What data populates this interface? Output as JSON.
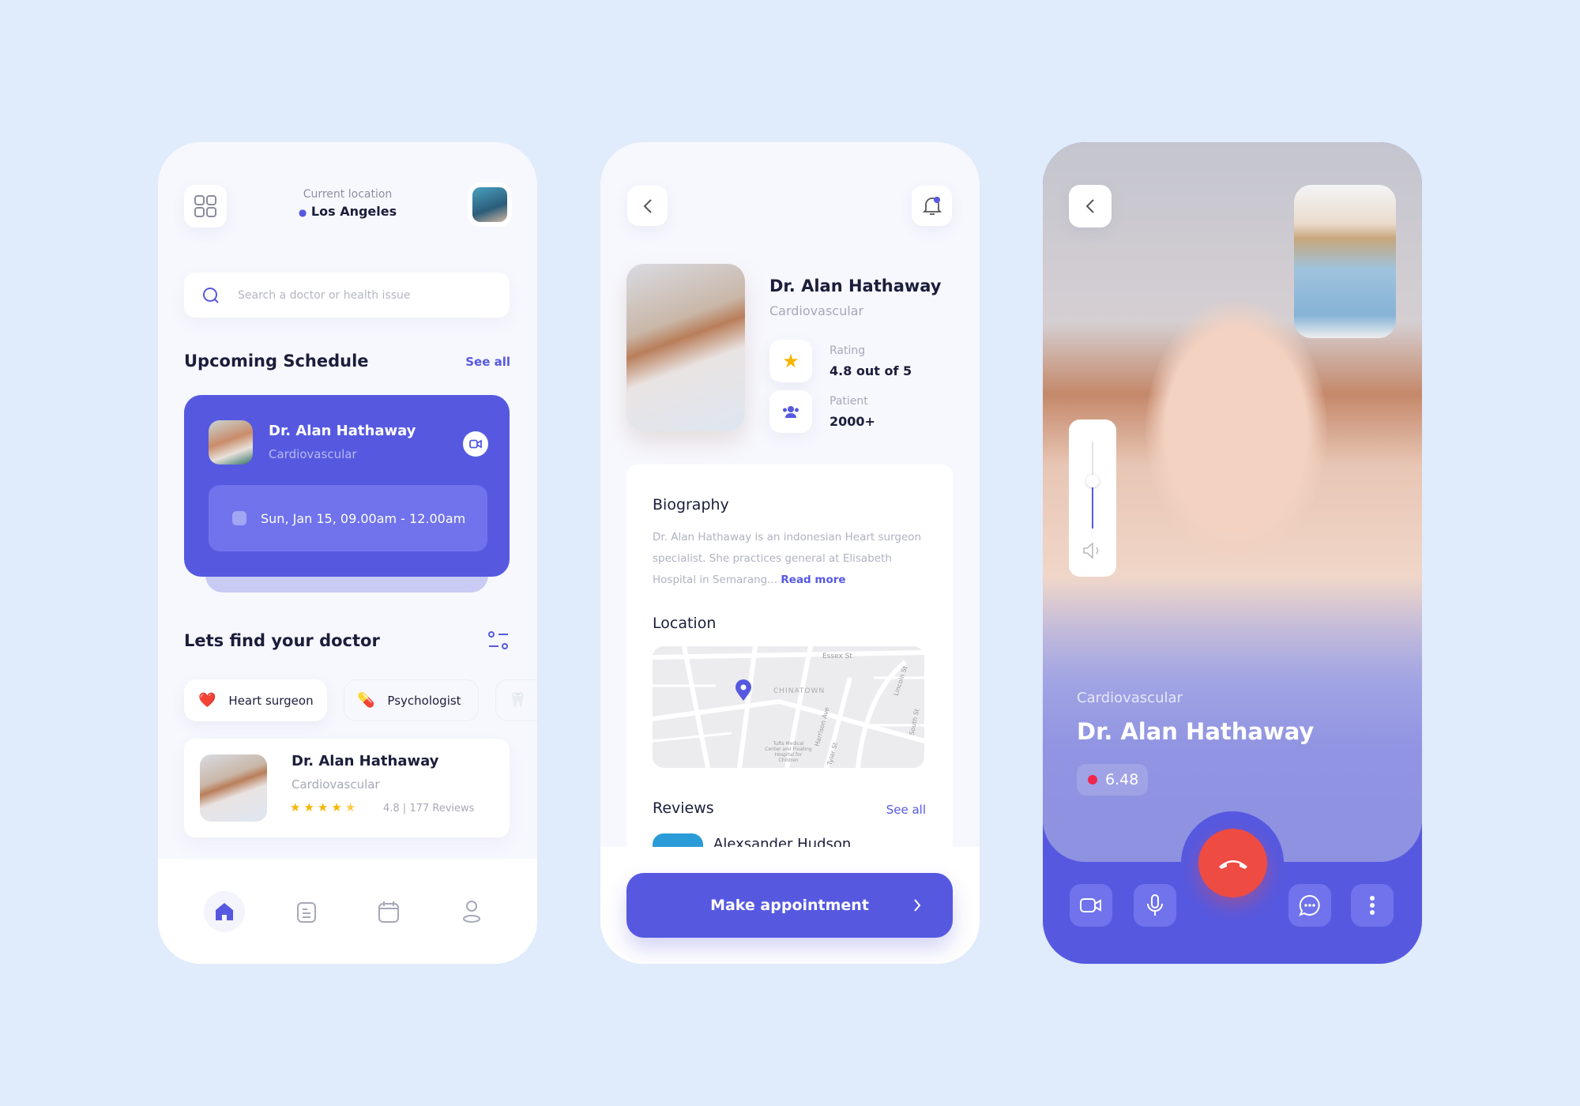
{
  "colors": {
    "background": "#e0ebfb",
    "primary": "#5659e0",
    "end_call": "#ee4b43",
    "star": "#f7b500",
    "text": "#1b1d3a"
  },
  "home": {
    "menu_icon": "grid-icon",
    "location_label": "Current location",
    "location_value": "Los Angeles",
    "search_placeholder": "Search a doctor or health issue",
    "schedule_title": "Upcoming Schedule",
    "schedule_see_all": "See all",
    "appointment": {
      "name": "Dr. Alan Hathaway",
      "specialty": "Cardiovascular",
      "time": "Sun, Jan 15, 09.00am - 12.00am"
    },
    "find_title": "Lets find your doctor",
    "categories": [
      {
        "label": "Heart surgeon",
        "icon": "❤️"
      },
      {
        "label": "Psychologist",
        "icon": "💊"
      },
      {
        "label": "",
        "icon": "🦷"
      }
    ],
    "doctor": {
      "name": "Dr. Alan Hathaway",
      "specialty": "Cardiovascular",
      "rating": 4.5,
      "rating_text": "4.8 | 177 Reviews"
    },
    "nav": [
      "home",
      "document",
      "calendar",
      "profile"
    ]
  },
  "detail": {
    "name": "Dr. Alan Hathaway",
    "specialty": "Cardiovascular",
    "rating_label": "Rating",
    "rating_value": "4.8 out of 5",
    "patient_label": "Patient",
    "patient_value": "2000+",
    "bio_title": "Biography",
    "bio_lines": [
      "Dr. Alan Hathaway is an indonesian Heart surgeon",
      "specialist. She practices general at Elisabeth",
      "Hospital in Semarang..."
    ],
    "read_more": "Read more",
    "location_title": "Location",
    "map_labels": {
      "a": "Essex St",
      "b": "CHINATOWN",
      "c": "Lincoln St",
      "d": "Harrison Ave",
      "e": "Tyler St",
      "f": "Tufts Medical Center and Floating Hospital for Children",
      "g": "South St"
    },
    "reviews_title": "Reviews",
    "reviews_see_all": "See all",
    "reviewer": "Alexsander Hudson",
    "cta": "Make appointment"
  },
  "call": {
    "specialty": "Cardiovascular",
    "name": "Dr. Alan Hathaway",
    "timer": "6.48",
    "volume": 0.55
  }
}
